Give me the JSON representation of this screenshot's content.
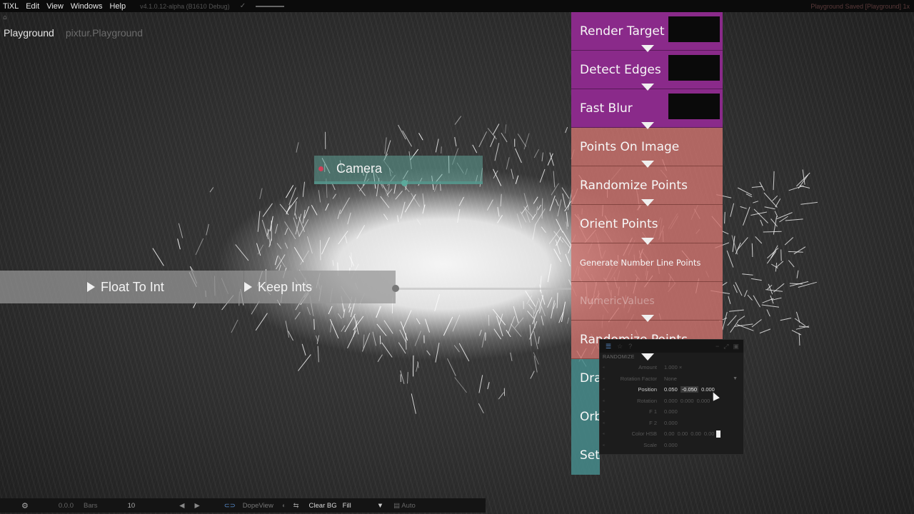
{
  "menubar": {
    "app": "TiXL",
    "items": [
      "Edit",
      "View",
      "Windows",
      "Help"
    ],
    "version": "v4.1.0.12-alpha (B1610 Debug)",
    "status_right": "Playground Saved [Playground] 1x"
  },
  "breadcrumb": {
    "current": "Playground",
    "path": "pixtur.Playground"
  },
  "graph": {
    "camera_label": "Camera",
    "float_to_int_label": "Float To Int",
    "keep_ints_label": "Keep Ints",
    "stack": [
      {
        "label": "Render Target",
        "color": "purple",
        "thumb": true
      },
      {
        "label": "Detect Edges",
        "color": "purple",
        "thumb": true
      },
      {
        "label": "Fast Blur",
        "color": "purple",
        "thumb": true
      },
      {
        "label": "Points On Image",
        "color": "salmon"
      },
      {
        "label": "Randomize Points",
        "color": "salmon"
      },
      {
        "label": "Orient Points",
        "color": "salmon"
      },
      {
        "label": "Generate Number Line Points",
        "color": "salmon",
        "size": "small"
      },
      {
        "label": "NumericValues",
        "color": "salmon",
        "size": "faded"
      },
      {
        "label": "Randomize Points",
        "color": "salmon"
      },
      {
        "label": "Dra",
        "color": "teal"
      },
      {
        "label": "Orb",
        "color": "teal"
      },
      {
        "label": "Set",
        "color": "teal"
      }
    ]
  },
  "inspector": {
    "heading": "RANDOMIZE",
    "params": [
      {
        "name": "Amount",
        "values": [
          "1.000 ×"
        ],
        "highlight": false
      },
      {
        "name": "Rotation Factor",
        "values": [
          "None"
        ],
        "highlight": false,
        "dropdown": true
      },
      {
        "name": "Position",
        "values": [
          "0.050",
          "-0.050",
          "0.000"
        ],
        "highlight": true
      },
      {
        "name": "Rotation",
        "values": [
          "0.000",
          "0.000",
          "0.000"
        ],
        "highlight": false
      },
      {
        "name": "F 1",
        "values": [
          "0.000"
        ],
        "highlight": false
      },
      {
        "name": "F 2",
        "values": [
          "0.000"
        ],
        "highlight": false
      },
      {
        "name": "Color HSB",
        "values": [
          "0.00",
          "0.00",
          "0.00",
          "0.00"
        ],
        "highlight": false,
        "swatch": true
      },
      {
        "name": "Scale",
        "values": [
          "0.000"
        ],
        "highlight": false
      }
    ]
  },
  "toolbar": {
    "time": "0.0.0",
    "unit": "Bars",
    "bpm_value": "10",
    "dopeview_label": "DopeView",
    "clear_bg_label": "Clear BG",
    "fill_label": "Fill",
    "auto_label": "Auto"
  },
  "colors": {
    "purple_node": "#8a2a8a",
    "salmon_node": "#cd736e",
    "teal_node": "#468c8c",
    "camera_node": "#5fa096",
    "accent": "#5a8fd0"
  }
}
